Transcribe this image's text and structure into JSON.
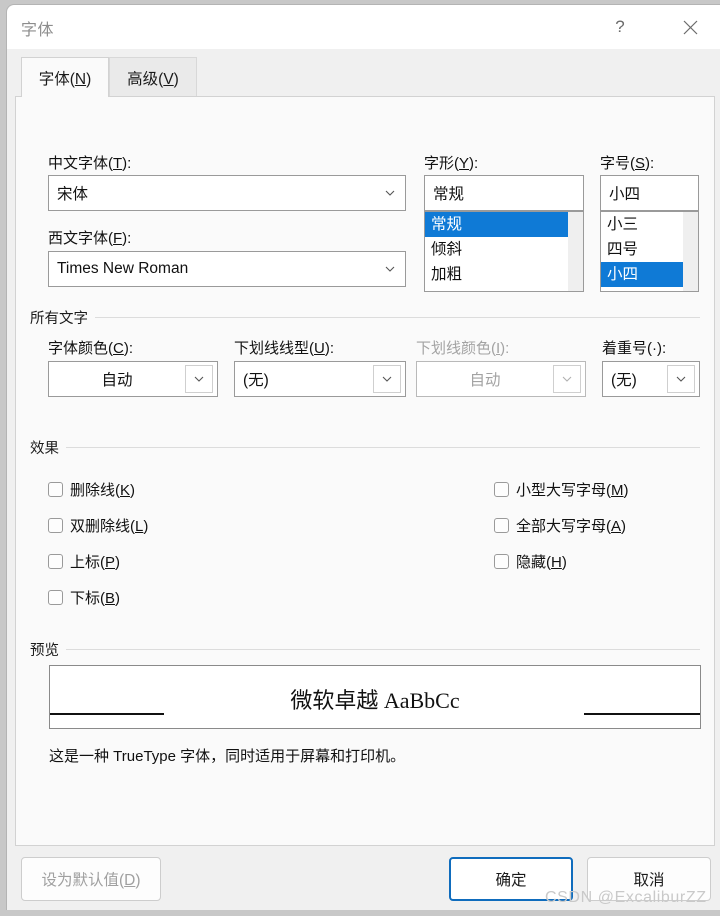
{
  "window": {
    "title": "字体",
    "help_icon": "question-mark-icon",
    "close_icon": "close-icon"
  },
  "tabs": [
    {
      "label": "字体(N)",
      "active": true
    },
    {
      "label": "高级(V)",
      "active": false
    }
  ],
  "fields": {
    "chinese_font": {
      "label": "中文字体(T):",
      "value": "宋体"
    },
    "western_font": {
      "label": "西文字体(F):",
      "value": "Times New Roman"
    },
    "font_style": {
      "label": "字形(Y):",
      "value": "常规",
      "options": [
        "常规",
        "倾斜",
        "加粗"
      ],
      "selected": "常规"
    },
    "font_size": {
      "label": "字号(S):",
      "value": "小四",
      "options": [
        "小三",
        "四号",
        "小四"
      ],
      "selected": "小四"
    }
  },
  "all_text": {
    "group_label": "所有文字",
    "font_color": {
      "label": "字体颜色(C):",
      "value": "自动",
      "disabled": false
    },
    "underline_style": {
      "label": "下划线线型(U):",
      "value": "(无)",
      "disabled": false
    },
    "underline_color": {
      "label": "下划线颜色(I):",
      "value": "自动",
      "disabled": true
    },
    "emphasis_mark": {
      "label": "着重号(·):",
      "value": "(无)",
      "disabled": false
    }
  },
  "effects": {
    "group_label": "效果",
    "left_column": [
      {
        "label": "删除线(K)",
        "checked": false
      },
      {
        "label": "双删除线(L)",
        "checked": false
      },
      {
        "label": "上标(P)",
        "checked": false
      },
      {
        "label": "下标(B)",
        "checked": false
      }
    ],
    "right_column": [
      {
        "label": "小型大写字母(M)",
        "checked": false
      },
      {
        "label": "全部大写字母(A)",
        "checked": false
      },
      {
        "label": "隐藏(H)",
        "checked": false
      }
    ]
  },
  "preview": {
    "group_label": "预览",
    "sample_text": "微软卓越  AaBbCc",
    "note": "这是一种 TrueType 字体，同时适用于屏幕和打印机。"
  },
  "footer": {
    "set_default_label": "设为默认值(D)",
    "ok_label": "确定",
    "cancel_label": "取消"
  },
  "watermark": "CSDN @ExcaliburZZ",
  "colors": {
    "accent": "#0f7ad6",
    "default_button_border": "#0f6cbd",
    "disabled_text": "#a3a3a3"
  }
}
